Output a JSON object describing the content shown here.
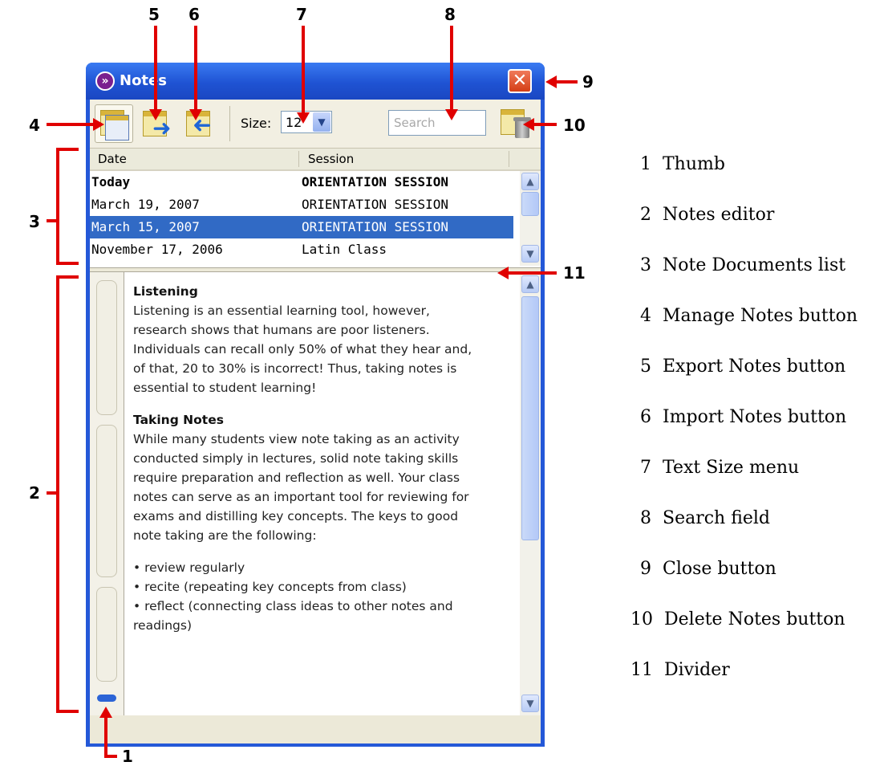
{
  "window": {
    "title": "Notes",
    "close_glyph": "✕"
  },
  "toolbar": {
    "size_label": "Size:",
    "size_value": "12",
    "search_placeholder": "Search"
  },
  "list": {
    "columns": [
      "Date",
      "Session"
    ],
    "rows": [
      {
        "date": "Today",
        "session": "ORIENTATION SESSION",
        "bold": true,
        "selected": false
      },
      {
        "date": "March 19, 2007",
        "session": "ORIENTATION SESSION",
        "bold": false,
        "selected": false
      },
      {
        "date": "March 15, 2007",
        "session": "ORIENTATION SESSION",
        "bold": false,
        "selected": true
      },
      {
        "date": "November 17, 2006",
        "session": "Latin Class",
        "bold": false,
        "selected": false
      }
    ]
  },
  "notes": {
    "heading1": "Listening",
    "para1": "Listening is an essential learning tool, however, research shows that humans are poor listeners. Individuals can recall only 50% of what they hear and, of that, 20 to 30% is incorrect! Thus, taking notes  is essential to student learning!",
    "heading2": "Taking Notes",
    "para2": "While many students view note taking as an activity conducted simply in lectures, solid note taking skills require preparation and reflection as well. Your class notes can serve as an important tool for reviewing for exams and distilling key concepts. The keys to good note taking are the following:",
    "bullets": [
      "• review regularly",
      "• recite (repeating key concepts from class)",
      "• reflect (connecting class ideas to other notes and readings)"
    ]
  },
  "callouts": [
    "1",
    "2",
    "3",
    "4",
    "5",
    "6",
    "7",
    "8",
    "9",
    "10",
    "11"
  ],
  "legend": [
    {
      "num": "1",
      "label": "Thumb"
    },
    {
      "num": "2",
      "label": "Notes editor"
    },
    {
      "num": "3",
      "label": "Note Documents list"
    },
    {
      "num": "4",
      "label": "Manage Notes button"
    },
    {
      "num": "5",
      "label": "Export Notes button"
    },
    {
      "num": "6",
      "label": "Import Notes button"
    },
    {
      "num": "7",
      "label": "Text Size menu"
    },
    {
      "num": "8",
      "label": "Search field"
    },
    {
      "num": "9",
      "label": "Close button"
    },
    {
      "num": "10",
      "label": "Delete Notes button"
    },
    {
      "num": "11",
      "label": "Divider"
    }
  ],
  "colors": {
    "window_frame": "#2458d8",
    "selection": "#316ac5",
    "callout": "#e00000"
  },
  "icons": [
    "notes-app-icon",
    "close-icon",
    "manage-notes-icon",
    "export-notes-icon",
    "import-notes-icon",
    "chevron-down-icon",
    "delete-notes-icon",
    "scroll-up-icon",
    "scroll-down-icon"
  ]
}
